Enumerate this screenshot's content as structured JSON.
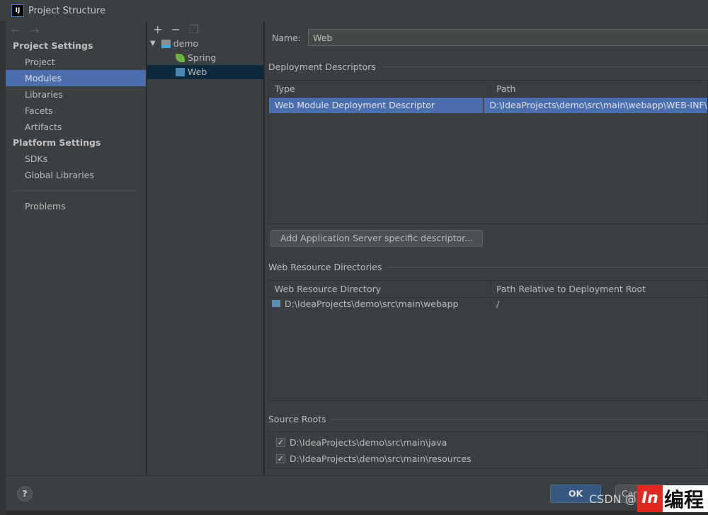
{
  "window": {
    "title": "Project Structure",
    "logo": "IJ"
  },
  "sidebar": {
    "section1": "Project Settings",
    "items1": [
      "Project",
      "Modules",
      "Libraries",
      "Facets",
      "Artifacts"
    ],
    "section2": "Platform Settings",
    "items2": [
      "SDKs",
      "Global Libraries"
    ],
    "problems": "Problems",
    "selected": "Modules"
  },
  "tree": {
    "nodes": [
      "demo",
      "Spring",
      "Web"
    ],
    "selected": "Web"
  },
  "detail": {
    "name_label": "Name:",
    "name_value": "Web",
    "deploy": {
      "title": "Deployment Descriptors",
      "headers": [
        "Type",
        "Path"
      ],
      "rows": [
        [
          "Web Module Deployment Descriptor",
          "D:\\IdeaProjects\\demo\\src\\main\\webapp\\WEB-INF\\w"
        ]
      ],
      "add_button": "Add Application Server specific descriptor..."
    },
    "resources": {
      "title": "Web Resource Directories",
      "headers": [
        "Web Resource Directory",
        "Path Relative to Deployment Root"
      ],
      "rows": [
        [
          "D:\\IdeaProjects\\demo\\src\\main\\webapp",
          "/"
        ]
      ]
    },
    "sources": {
      "title": "Source Roots",
      "items": [
        {
          "path": "D:\\IdeaProjects\\demo\\src\\main\\java",
          "checked": true
        },
        {
          "path": "D:\\IdeaProjects\\demo\\src\\main\\resources",
          "checked": true
        }
      ]
    }
  },
  "footer": {
    "help": "?",
    "ok": "OK",
    "cancel": "Can"
  },
  "watermark": {
    "text": "CSDN @",
    "logo": "编程"
  }
}
